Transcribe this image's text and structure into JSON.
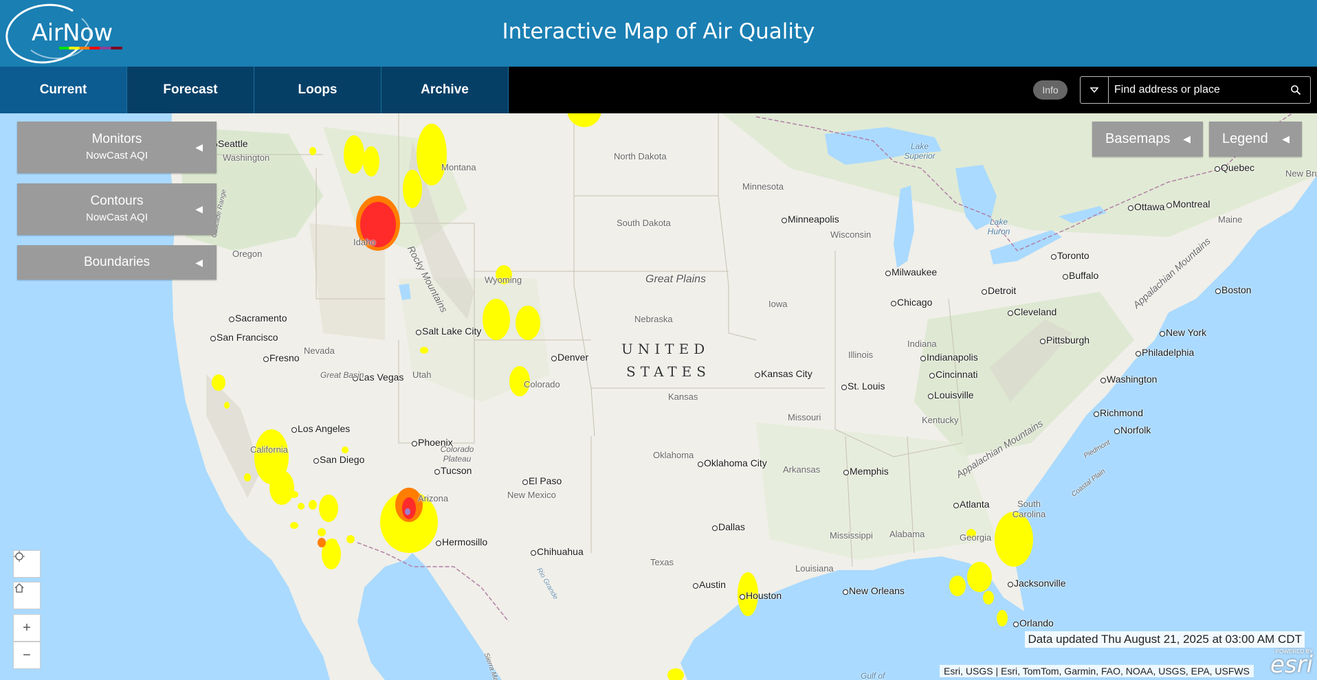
{
  "header": {
    "logo_text": "AirNow",
    "title": "Interactive Map of Air Quality"
  },
  "nav": {
    "tabs": [
      {
        "label": "Current",
        "active": true
      },
      {
        "label": "Forecast",
        "active": false
      },
      {
        "label": "Loops",
        "active": false
      },
      {
        "label": "Archive",
        "active": false
      }
    ],
    "info_label": "Info",
    "search": {
      "placeholder": "Find address or place",
      "value": ""
    }
  },
  "panels": {
    "monitors": {
      "title": "Monitors",
      "subtitle": "NowCast AQI"
    },
    "contours": {
      "title": "Contours",
      "subtitle": "NowCast AQI"
    },
    "boundaries": {
      "title": "Boundaries"
    },
    "basemaps": {
      "title": "Basemaps"
    },
    "legend": {
      "title": "Legend"
    }
  },
  "map_labels": {
    "cities": [
      "Seattle",
      "Sacramento",
      "San Francisco",
      "Fresno",
      "Los Angeles",
      "San Diego",
      "Las Vegas",
      "Salt Lake City",
      "Denver",
      "Phoenix",
      "Tucson",
      "El Paso",
      "Hermosillo",
      "Chihuahua",
      "Minneapolis",
      "Milwaukee",
      "Chicago",
      "Detroit",
      "Toronto",
      "Buffalo",
      "Ottawa",
      "Montreal",
      "Quebec",
      "Boston",
      "New York",
      "Philadelphia",
      "Pittsburgh",
      "Cleveland",
      "Washington",
      "Richmond",
      "Norfolk",
      "Indianapolis",
      "Cincinnati",
      "Louisville",
      "St. Louis",
      "Kansas City",
      "Oklahoma City",
      "Dallas",
      "Austin",
      "Houston",
      "Memphis",
      "New Orleans",
      "Atlanta",
      "Jacksonville",
      "Orlando"
    ],
    "states": [
      "Washington",
      "Oregon",
      "Idaho",
      "Montana",
      "North Dakota",
      "South Dakota",
      "Minnesota",
      "Wisconsin",
      "Wyoming",
      "Nebraska",
      "Iowa",
      "Nevada",
      "Utah",
      "Colorado",
      "Kansas",
      "Illinois",
      "Indiana",
      "Missouri",
      "Kentucky",
      "California",
      "Arizona",
      "New Mexico",
      "Oklahoma",
      "Arkansas",
      "Texas",
      "Louisiana",
      "Mississippi",
      "Alabama",
      "Georgia",
      "South Carolina",
      "Maine",
      "New Brunswick"
    ],
    "regions": [
      "Great Plains",
      "Rocky Mountains",
      "Great Basin",
      "Colorado Plateau",
      "Appalachian Mountains",
      "Cascade Range",
      "Piedmont",
      "Coastal Plain",
      "Rio Grande",
      "Sierra Madre"
    ],
    "water": [
      "Lake Superior",
      "Lake Huron",
      "Gulf of"
    ],
    "country": [
      "UNITED",
      "STATES"
    ]
  },
  "controls": {
    "zoom_in": "+",
    "zoom_out": "−"
  },
  "footer": {
    "updated": "Data updated Thu August 21, 2025 at 03:00 AM CDT",
    "attribution": "Esri, USGS | Esri, TomTom, Garmin, FAO, NOAA, USGS, EPA, USFWS",
    "esri_powered": "POWERED BY",
    "esri": "esri"
  },
  "aqi_colors": {
    "moderate": "#ffff00",
    "usg": "#ff7e00",
    "unhealthy": "#ff0000",
    "very_unhealthy": "#8f3f97"
  }
}
